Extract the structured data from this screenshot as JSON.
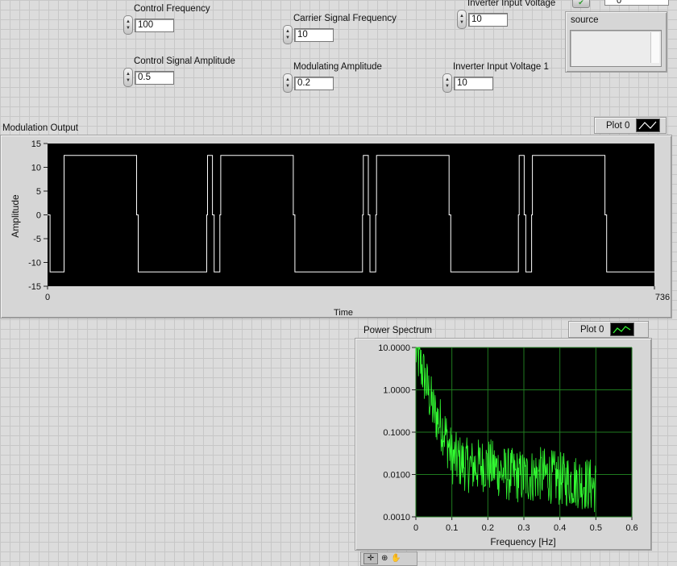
{
  "controls": {
    "control_frequency": {
      "label": "Control Frequency",
      "value": "100"
    },
    "control_signal_amplitude": {
      "label": "Control Signal Amplitude",
      "value": "0.5"
    },
    "carrier_signal_frequency": {
      "label": "Carrier Signal Frequency",
      "value": "10"
    },
    "modulating_amplitude": {
      "label": "Modulating Amplitude",
      "value": "0.2"
    },
    "inverter_input_voltage": {
      "label": "Inverter Input Voltage",
      "value": "10"
    },
    "inverter_input_voltage_1": {
      "label": "Inverter Input Voltage 1",
      "value": "10"
    },
    "top_right_value": "0"
  },
  "source": {
    "label": "source"
  },
  "modulation_graph": {
    "title": "Modulation Output",
    "legend": "Plot 0"
  },
  "power_graph": {
    "title": "Power Spectrum",
    "legend": "Plot 0"
  },
  "chart_data": [
    {
      "type": "line",
      "title": "Modulation Output",
      "xlabel": "Time",
      "ylabel": "Amplitude",
      "xlim": [
        0,
        736
      ],
      "ylim": [
        -15,
        15
      ],
      "x_ticks": [
        "0",
        "736"
      ],
      "y_ticks": [
        "15",
        "10",
        "5",
        "0",
        "-5",
        "-10",
        "-15"
      ],
      "grid": false,
      "line_color": "#ffffff",
      "background": "#000000",
      "series": [
        {
          "name": "Plot 0",
          "points": [
            [
              0,
              0
            ],
            [
              3,
              0
            ],
            [
              3,
              -12
            ],
            [
              20,
              -12
            ],
            [
              20,
              12.5
            ],
            [
              108,
              12.5
            ],
            [
              108,
              0
            ],
            [
              110,
              0
            ],
            [
              110,
              -12
            ],
            [
              193,
              -12
            ],
            [
              193,
              0
            ],
            [
              194,
              0
            ],
            [
              194,
              12.5
            ],
            [
              200,
              12.5
            ],
            [
              200,
              0
            ],
            [
              202,
              0
            ],
            [
              202,
              -12
            ],
            [
              209,
              -12
            ],
            [
              209,
              0
            ],
            [
              210,
              0
            ],
            [
              210,
              12.5
            ],
            [
              298,
              12.5
            ],
            [
              298,
              0
            ],
            [
              300,
              0
            ],
            [
              300,
              -12
            ],
            [
              382,
              -12
            ],
            [
              382,
              0
            ],
            [
              383,
              0
            ],
            [
              383,
              12.5
            ],
            [
              389,
              12.5
            ],
            [
              389,
              0
            ],
            [
              391,
              0
            ],
            [
              391,
              -12
            ],
            [
              398,
              -12
            ],
            [
              398,
              0
            ],
            [
              399,
              0
            ],
            [
              399,
              12.5
            ],
            [
              487,
              12.5
            ],
            [
              487,
              0
            ],
            [
              489,
              0
            ],
            [
              489,
              -12
            ],
            [
              571,
              -12
            ],
            [
              571,
              0
            ],
            [
              572,
              0
            ],
            [
              572,
              12.5
            ],
            [
              578,
              12.5
            ],
            [
              578,
              0
            ],
            [
              580,
              0
            ],
            [
              580,
              -12
            ],
            [
              587,
              -12
            ],
            [
              587,
              0
            ],
            [
              588,
              0
            ],
            [
              588,
              12.5
            ],
            [
              676,
              12.5
            ],
            [
              676,
              0
            ],
            [
              678,
              0
            ],
            [
              678,
              -12
            ],
            [
              736,
              -12
            ]
          ]
        }
      ]
    },
    {
      "type": "line",
      "title": "Power Spectrum",
      "xlabel": "Frequency [Hz]",
      "ylabel": "",
      "xlim": [
        0,
        0.6
      ],
      "ylim": [
        0.001,
        10
      ],
      "y_scale": "log",
      "x_ticks": [
        "0",
        "0.1",
        "0.2",
        "0.3",
        "0.4",
        "0.5",
        "0.6"
      ],
      "y_ticks": [
        "10.0000",
        "1.0000",
        "0.1000",
        "0.0100",
        "0.0010"
      ],
      "grid": true,
      "grid_color": "#1f7a1f",
      "line_color": "#33ff33",
      "background": "#000000",
      "series": [
        {
          "name": "Plot 0",
          "x_range": [
            0,
            0.5
          ],
          "envelope": [
            [
              0,
              10
            ],
            [
              0.02,
              3
            ],
            [
              0.05,
              0.35
            ],
            [
              0.08,
              0.12
            ],
            [
              0.1,
              0.03
            ],
            [
              0.15,
              0.018
            ],
            [
              0.2,
              0.02
            ],
            [
              0.25,
              0.012
            ],
            [
              0.3,
              0.01
            ],
            [
              0.35,
              0.012
            ],
            [
              0.4,
              0.009
            ],
            [
              0.45,
              0.008
            ],
            [
              0.5,
              0.006
            ]
          ]
        }
      ]
    }
  ]
}
